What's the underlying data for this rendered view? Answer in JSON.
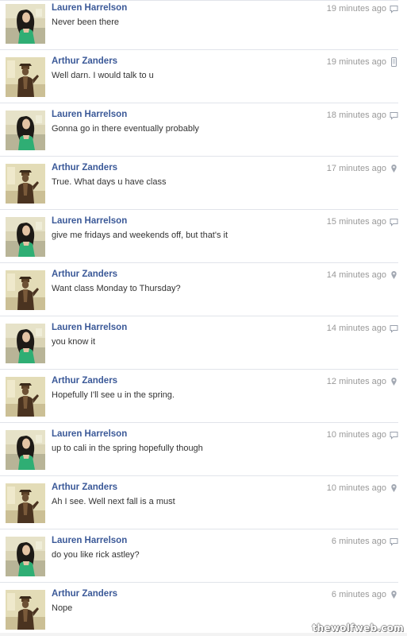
{
  "thread": {
    "messages": [
      {
        "sender": "Lauren Harrelson",
        "text": "Never been there",
        "time": "19 minutes ago",
        "source_icon": "chat-bubble-icon",
        "avatar": "lauren"
      },
      {
        "sender": "Arthur Zanders",
        "text": "Well darn. I would talk to u",
        "time": "19 minutes ago",
        "source_icon": "mobile-phone-icon",
        "avatar": "arthur"
      },
      {
        "sender": "Lauren Harrelson",
        "text": "Gonna go in there eventually probably",
        "time": "18 minutes ago",
        "source_icon": "chat-bubble-icon",
        "avatar": "lauren"
      },
      {
        "sender": "Arthur Zanders",
        "text": "True. What days u have class",
        "time": "17 minutes ago",
        "source_icon": "location-pin-icon",
        "avatar": "arthur"
      },
      {
        "sender": "Lauren Harrelson",
        "text": "give me fridays and weekends off, but that's it",
        "time": "15 minutes ago",
        "source_icon": "chat-bubble-icon",
        "avatar": "lauren"
      },
      {
        "sender": "Arthur Zanders",
        "text": "Want class Monday to Thursday?",
        "time": "14 minutes ago",
        "source_icon": "location-pin-icon",
        "avatar": "arthur"
      },
      {
        "sender": "Lauren Harrelson",
        "text": "you know it",
        "time": "14 minutes ago",
        "source_icon": "chat-bubble-icon",
        "avatar": "lauren"
      },
      {
        "sender": "Arthur Zanders",
        "text": "Hopefully I'll see u in the spring.",
        "time": "12 minutes ago",
        "source_icon": "location-pin-icon",
        "avatar": "arthur"
      },
      {
        "sender": "Lauren Harrelson",
        "text": "up to cali in the spring hopefully though",
        "time": "10 minutes ago",
        "source_icon": "chat-bubble-icon",
        "avatar": "lauren"
      },
      {
        "sender": "Arthur Zanders",
        "text": "Ah I see. Well next fall is a must",
        "time": "10 minutes ago",
        "source_icon": "location-pin-icon",
        "avatar": "arthur"
      },
      {
        "sender": "Lauren Harrelson",
        "text": "do you like rick astley?",
        "time": "6 minutes ago",
        "source_icon": "chat-bubble-icon",
        "avatar": "lauren"
      },
      {
        "sender": "Arthur Zanders",
        "text": "Nope",
        "time": "6 minutes ago",
        "source_icon": "location-pin-icon",
        "avatar": "arthur"
      }
    ]
  },
  "watermark": "thewolfweb.com",
  "colors": {
    "sender_name": "#3b5998",
    "message_text": "#333333",
    "timestamp": "#999999",
    "divider": "#e1e4ea"
  }
}
